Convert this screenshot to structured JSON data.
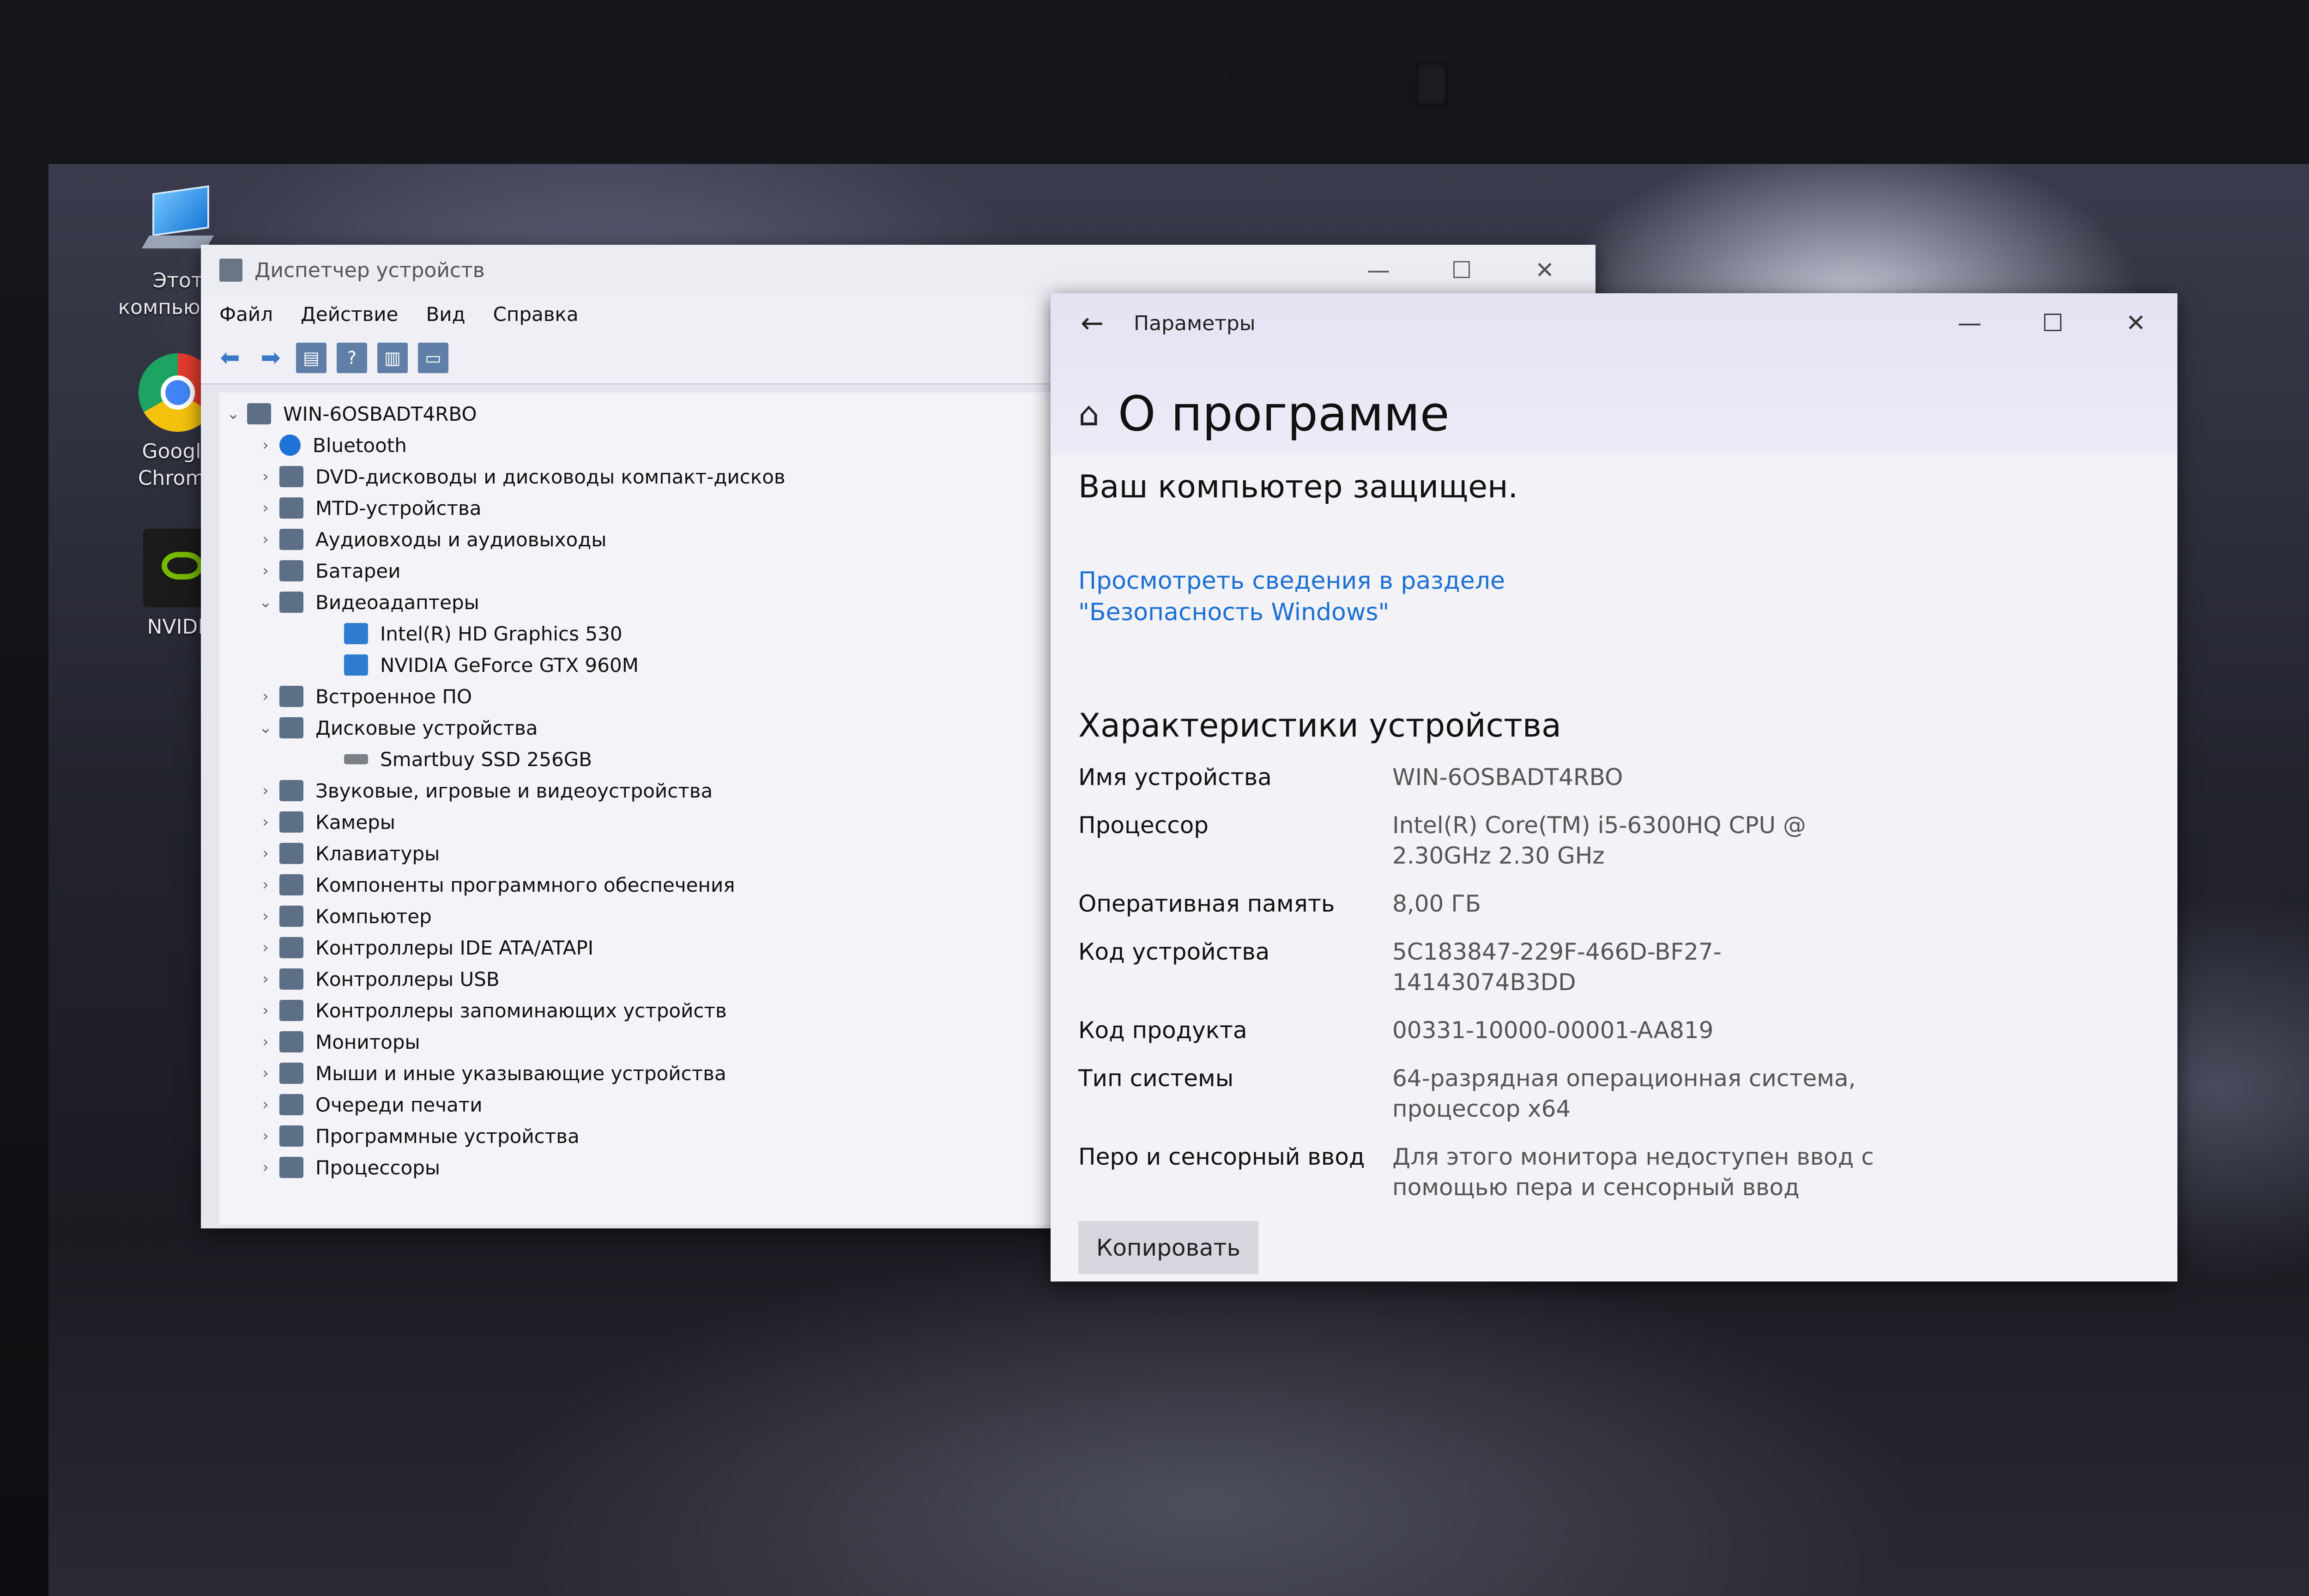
{
  "desktop": {
    "icons": [
      {
        "label_line1": "Этот",
        "label_line2": "компьютер"
      },
      {
        "label_line1": "Google",
        "label_line2": "Chrome"
      },
      {
        "label_line1": "NVIDIA",
        "label_line2": ""
      }
    ]
  },
  "device_manager": {
    "title": "Диспетчер устройств",
    "menu": [
      "Файл",
      "Действие",
      "Вид",
      "Справка"
    ],
    "tree": [
      {
        "label": "WIN-6OSBADT4RBO",
        "level": 0,
        "arrow": "⌄"
      },
      {
        "label": "Bluetooth",
        "level": 1,
        "arrow": "›"
      },
      {
        "label": "DVD-дисководы и дисководы компакт-дисков",
        "level": 1,
        "arrow": "›"
      },
      {
        "label": "MTD-устройства",
        "level": 1,
        "arrow": "›"
      },
      {
        "label": "Аудиовходы и аудиовыходы",
        "level": 1,
        "arrow": "›"
      },
      {
        "label": "Батареи",
        "level": 1,
        "arrow": "›"
      },
      {
        "label": "Видеоадаптеры",
        "level": 1,
        "arrow": "⌄"
      },
      {
        "label": "Intel(R) HD Graphics 530",
        "level": 2,
        "arrow": ""
      },
      {
        "label": "NVIDIA GeForce GTX 960M",
        "level": 2,
        "arrow": ""
      },
      {
        "label": "Встроенное ПО",
        "level": 1,
        "arrow": "›"
      },
      {
        "label": "Дисковые устройства",
        "level": 1,
        "arrow": "⌄"
      },
      {
        "label": "Smartbuy SSD 256GB",
        "level": 2,
        "arrow": ""
      },
      {
        "label": "Звуковые, игровые и видеоустройства",
        "level": 1,
        "arrow": "›"
      },
      {
        "label": "Камеры",
        "level": 1,
        "arrow": "›"
      },
      {
        "label": "Клавиатуры",
        "level": 1,
        "arrow": "›"
      },
      {
        "label": "Компоненты программного обеспечения",
        "level": 1,
        "arrow": "›"
      },
      {
        "label": "Компьютер",
        "level": 1,
        "arrow": "›"
      },
      {
        "label": "Контроллеры IDE ATA/ATAPI",
        "level": 1,
        "arrow": "›"
      },
      {
        "label": "Контроллеры USB",
        "level": 1,
        "arrow": "›"
      },
      {
        "label": "Контроллеры запоминающих устройств",
        "level": 1,
        "arrow": "›"
      },
      {
        "label": "Мониторы",
        "level": 1,
        "arrow": "›"
      },
      {
        "label": "Мыши и иные указывающие устройства",
        "level": 1,
        "arrow": "›"
      },
      {
        "label": "Очереди печати",
        "level": 1,
        "arrow": "›"
      },
      {
        "label": "Программные устройства",
        "level": 1,
        "arrow": "›"
      },
      {
        "label": "Процессоры",
        "level": 1,
        "arrow": "›"
      }
    ]
  },
  "settings": {
    "window_title": "Параметры",
    "page_title": "О программе",
    "protected_text": "Ваш компьютер защищен.",
    "security_link": "Просмотреть сведения в разделе \"Безопасность Windows\"",
    "section_title": "Характеристики устройства",
    "specs": [
      {
        "key": "Имя устройства",
        "value": "WIN-6OSBADT4RBO"
      },
      {
        "key": "Процессор",
        "value": "Intel(R) Core(TM) i5-6300HQ CPU @ 2.30GHz   2.30 GHz"
      },
      {
        "key": "Оперативная память",
        "value": "8,00 ГБ"
      },
      {
        "key": "Код устройства",
        "value": "5C183847-229F-466D-BF27-14143074B3DD"
      },
      {
        "key": "Код продукта",
        "value": "00331-10000-00001-AA819"
      },
      {
        "key": "Тип системы",
        "value": "64-разрядная операционная система, процессор x64"
      },
      {
        "key": "Перо и сенсорный ввод",
        "value": "Для этого монитора недоступен ввод с помощью пера и сенсорный ввод"
      }
    ],
    "copy_button": "Копировать"
  }
}
